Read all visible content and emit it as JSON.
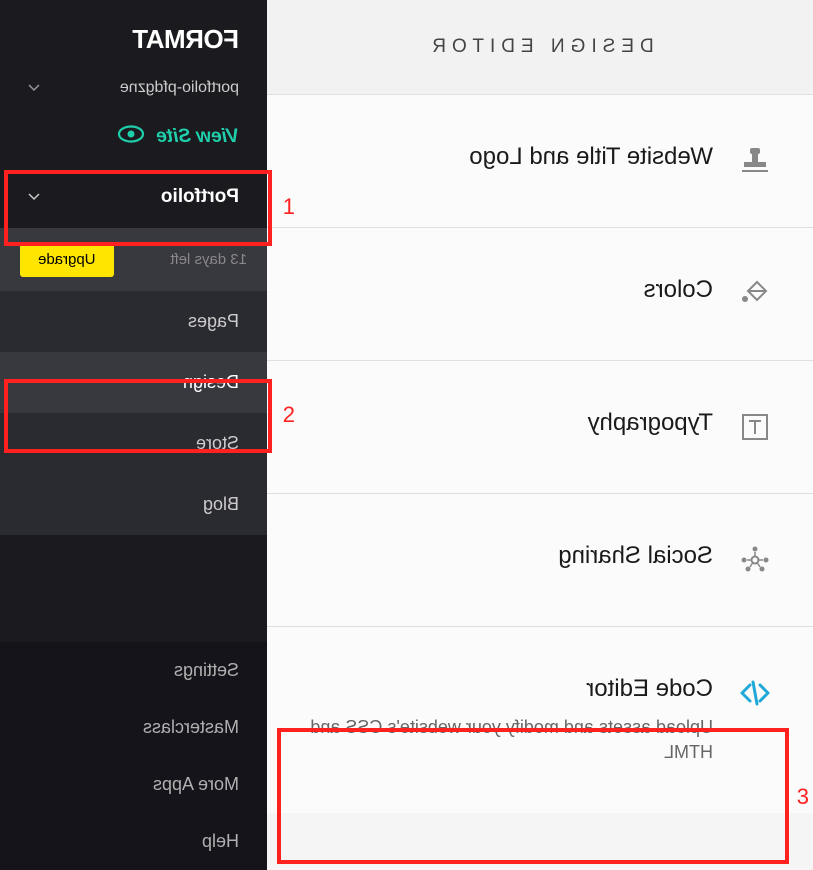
{
  "brand": "FORMAT",
  "sidebar": {
    "site_name": "portfolio-pfdgzne",
    "view_site_label": "View Site",
    "portfolio": {
      "label": "Portfolio",
      "trial_text": "13 days left",
      "upgrade_label": "Upgrade",
      "items": [
        {
          "label": "Pages",
          "active": false
        },
        {
          "label": "Design",
          "active": true
        },
        {
          "label": "Store",
          "active": false
        },
        {
          "label": "Blog",
          "active": false
        }
      ]
    },
    "bottom_items": [
      {
        "label": "Settings"
      },
      {
        "label": "Masterclass"
      },
      {
        "label": "More Apps"
      },
      {
        "label": "Help"
      }
    ]
  },
  "main": {
    "title": "DESIGN EDITOR",
    "items": [
      {
        "icon": "stamp-icon",
        "title": "Website Title and Logo",
        "desc": ""
      },
      {
        "icon": "paint-bucket-icon",
        "title": "Colors",
        "desc": ""
      },
      {
        "icon": "text-icon",
        "title": "Typography",
        "desc": ""
      },
      {
        "icon": "share-icon",
        "title": "Social Sharing",
        "desc": ""
      },
      {
        "icon": "code-icon",
        "title": "Code Editor",
        "desc": "Upload assets and modify your website's CSS and HTML"
      }
    ]
  },
  "annotations": {
    "n1": "1",
    "n2": "2",
    "n3": "3"
  }
}
